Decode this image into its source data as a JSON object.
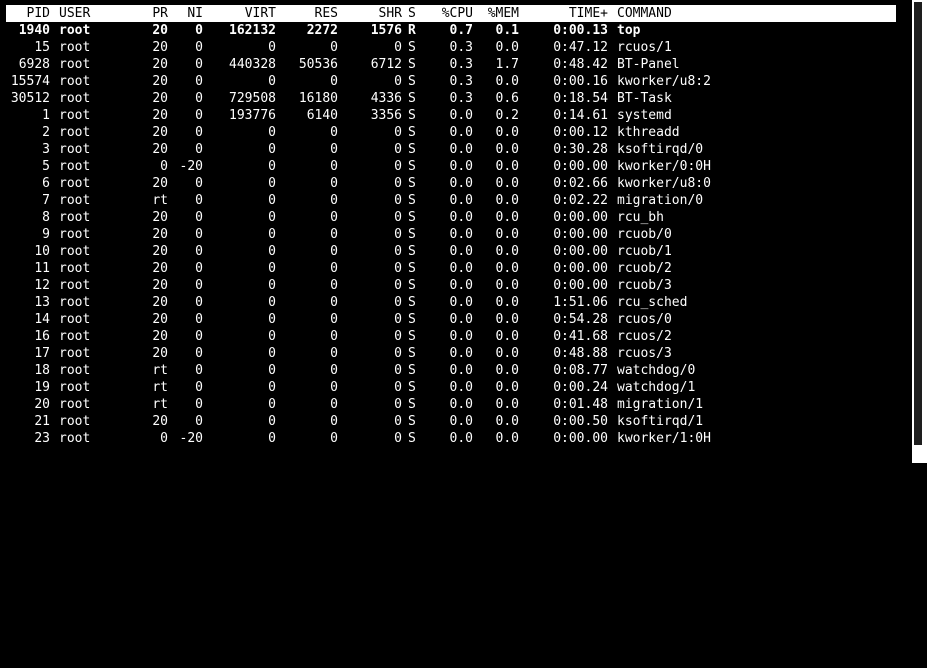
{
  "top": {
    "columns": {
      "pid": "PID",
      "user": "USER",
      "pr": "PR",
      "ni": "NI",
      "virt": "VIRT",
      "res": "RES",
      "shr": "SHR",
      "s": "S",
      "cpu": "%CPU",
      "mem": "%MEM",
      "time": "TIME+",
      "command": "COMMAND"
    },
    "processes": [
      {
        "pid": "1940",
        "user": "root",
        "pr": "20",
        "ni": "0",
        "virt": "162132",
        "res": "2272",
        "shr": "1576",
        "s": "R",
        "cpu": "0.7",
        "mem": "0.1",
        "time": "0:00.13",
        "command": "top",
        "highlight": true
      },
      {
        "pid": "15",
        "user": "root",
        "pr": "20",
        "ni": "0",
        "virt": "0",
        "res": "0",
        "shr": "0",
        "s": "S",
        "cpu": "0.3",
        "mem": "0.0",
        "time": "0:47.12",
        "command": "rcuos/1"
      },
      {
        "pid": "6928",
        "user": "root",
        "pr": "20",
        "ni": "0",
        "virt": "440328",
        "res": "50536",
        "shr": "6712",
        "s": "S",
        "cpu": "0.3",
        "mem": "1.7",
        "time": "0:48.42",
        "command": "BT-Panel"
      },
      {
        "pid": "15574",
        "user": "root",
        "pr": "20",
        "ni": "0",
        "virt": "0",
        "res": "0",
        "shr": "0",
        "s": "S",
        "cpu": "0.3",
        "mem": "0.0",
        "time": "0:00.16",
        "command": "kworker/u8:2"
      },
      {
        "pid": "30512",
        "user": "root",
        "pr": "20",
        "ni": "0",
        "virt": "729508",
        "res": "16180",
        "shr": "4336",
        "s": "S",
        "cpu": "0.3",
        "mem": "0.6",
        "time": "0:18.54",
        "command": "BT-Task"
      },
      {
        "pid": "1",
        "user": "root",
        "pr": "20",
        "ni": "0",
        "virt": "193776",
        "res": "6140",
        "shr": "3356",
        "s": "S",
        "cpu": "0.0",
        "mem": "0.2",
        "time": "0:14.61",
        "command": "systemd"
      },
      {
        "pid": "2",
        "user": "root",
        "pr": "20",
        "ni": "0",
        "virt": "0",
        "res": "0",
        "shr": "0",
        "s": "S",
        "cpu": "0.0",
        "mem": "0.0",
        "time": "0:00.12",
        "command": "kthreadd"
      },
      {
        "pid": "3",
        "user": "root",
        "pr": "20",
        "ni": "0",
        "virt": "0",
        "res": "0",
        "shr": "0",
        "s": "S",
        "cpu": "0.0",
        "mem": "0.0",
        "time": "0:30.28",
        "command": "ksoftirqd/0"
      },
      {
        "pid": "5",
        "user": "root",
        "pr": "0",
        "ni": "-20",
        "virt": "0",
        "res": "0",
        "shr": "0",
        "s": "S",
        "cpu": "0.0",
        "mem": "0.0",
        "time": "0:00.00",
        "command": "kworker/0:0H"
      },
      {
        "pid": "6",
        "user": "root",
        "pr": "20",
        "ni": "0",
        "virt": "0",
        "res": "0",
        "shr": "0",
        "s": "S",
        "cpu": "0.0",
        "mem": "0.0",
        "time": "0:02.66",
        "command": "kworker/u8:0"
      },
      {
        "pid": "7",
        "user": "root",
        "pr": "rt",
        "ni": "0",
        "virt": "0",
        "res": "0",
        "shr": "0",
        "s": "S",
        "cpu": "0.0",
        "mem": "0.0",
        "time": "0:02.22",
        "command": "migration/0"
      },
      {
        "pid": "8",
        "user": "root",
        "pr": "20",
        "ni": "0",
        "virt": "0",
        "res": "0",
        "shr": "0",
        "s": "S",
        "cpu": "0.0",
        "mem": "0.0",
        "time": "0:00.00",
        "command": "rcu_bh"
      },
      {
        "pid": "9",
        "user": "root",
        "pr": "20",
        "ni": "0",
        "virt": "0",
        "res": "0",
        "shr": "0",
        "s": "S",
        "cpu": "0.0",
        "mem": "0.0",
        "time": "0:00.00",
        "command": "rcuob/0"
      },
      {
        "pid": "10",
        "user": "root",
        "pr": "20",
        "ni": "0",
        "virt": "0",
        "res": "0",
        "shr": "0",
        "s": "S",
        "cpu": "0.0",
        "mem": "0.0",
        "time": "0:00.00",
        "command": "rcuob/1"
      },
      {
        "pid": "11",
        "user": "root",
        "pr": "20",
        "ni": "0",
        "virt": "0",
        "res": "0",
        "shr": "0",
        "s": "S",
        "cpu": "0.0",
        "mem": "0.0",
        "time": "0:00.00",
        "command": "rcuob/2"
      },
      {
        "pid": "12",
        "user": "root",
        "pr": "20",
        "ni": "0",
        "virt": "0",
        "res": "0",
        "shr": "0",
        "s": "S",
        "cpu": "0.0",
        "mem": "0.0",
        "time": "0:00.00",
        "command": "rcuob/3"
      },
      {
        "pid": "13",
        "user": "root",
        "pr": "20",
        "ni": "0",
        "virt": "0",
        "res": "0",
        "shr": "0",
        "s": "S",
        "cpu": "0.0",
        "mem": "0.0",
        "time": "1:51.06",
        "command": "rcu_sched"
      },
      {
        "pid": "14",
        "user": "root",
        "pr": "20",
        "ni": "0",
        "virt": "0",
        "res": "0",
        "shr": "0",
        "s": "S",
        "cpu": "0.0",
        "mem": "0.0",
        "time": "0:54.28",
        "command": "rcuos/0"
      },
      {
        "pid": "16",
        "user": "root",
        "pr": "20",
        "ni": "0",
        "virt": "0",
        "res": "0",
        "shr": "0",
        "s": "S",
        "cpu": "0.0",
        "mem": "0.0",
        "time": "0:41.68",
        "command": "rcuos/2"
      },
      {
        "pid": "17",
        "user": "root",
        "pr": "20",
        "ni": "0",
        "virt": "0",
        "res": "0",
        "shr": "0",
        "s": "S",
        "cpu": "0.0",
        "mem": "0.0",
        "time": "0:48.88",
        "command": "rcuos/3"
      },
      {
        "pid": "18",
        "user": "root",
        "pr": "rt",
        "ni": "0",
        "virt": "0",
        "res": "0",
        "shr": "0",
        "s": "S",
        "cpu": "0.0",
        "mem": "0.0",
        "time": "0:08.77",
        "command": "watchdog/0"
      },
      {
        "pid": "19",
        "user": "root",
        "pr": "rt",
        "ni": "0",
        "virt": "0",
        "res": "0",
        "shr": "0",
        "s": "S",
        "cpu": "0.0",
        "mem": "0.0",
        "time": "0:00.24",
        "command": "watchdog/1"
      },
      {
        "pid": "20",
        "user": "root",
        "pr": "rt",
        "ni": "0",
        "virt": "0",
        "res": "0",
        "shr": "0",
        "s": "S",
        "cpu": "0.0",
        "mem": "0.0",
        "time": "0:01.48",
        "command": "migration/1"
      },
      {
        "pid": "21",
        "user": "root",
        "pr": "20",
        "ni": "0",
        "virt": "0",
        "res": "0",
        "shr": "0",
        "s": "S",
        "cpu": "0.0",
        "mem": "0.0",
        "time": "0:00.50",
        "command": "ksoftirqd/1"
      },
      {
        "pid": "23",
        "user": "root",
        "pr": "0",
        "ni": "-20",
        "virt": "0",
        "res": "0",
        "shr": "0",
        "s": "S",
        "cpu": "0.0",
        "mem": "0.0",
        "time": "0:00.00",
        "command": "kworker/1:0H"
      }
    ]
  },
  "colors": {
    "background": "#000000",
    "text": "#ffffff",
    "header_bg": "#ffffff",
    "header_text": "#000000"
  }
}
